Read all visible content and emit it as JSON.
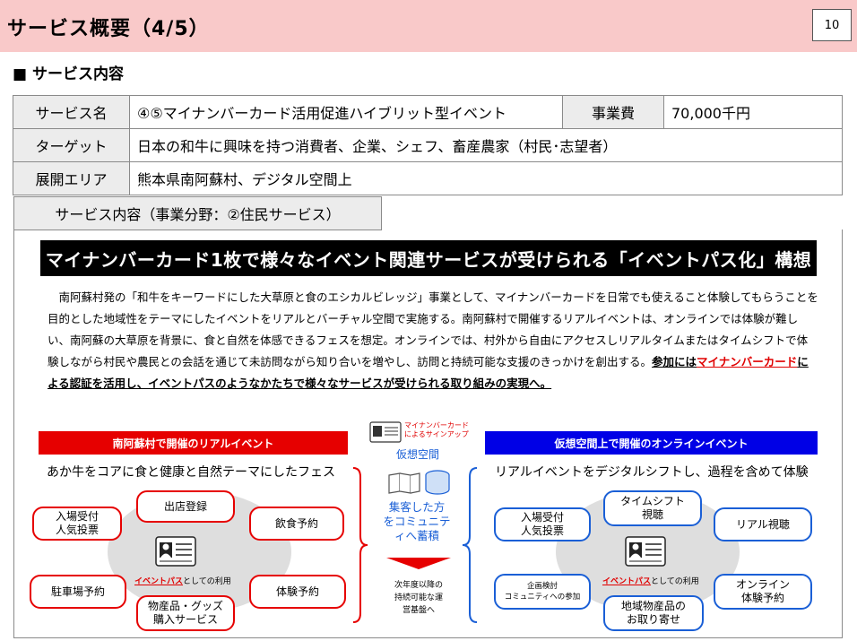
{
  "header": {
    "title": "サービス概要（4/5）",
    "page_number": "10"
  },
  "section": {
    "heading": "■ サービス内容"
  },
  "info_table": {
    "service_name_label": "サービス名",
    "service_name_value": "④⑤マイナンバーカード活用促進ハイブリット型イベント",
    "cost_label": "事業費",
    "cost_value": "70,000千円",
    "target_label": "ターゲット",
    "target_value": "日本の和牛に興味を持つ消費者、企業、シェフ、畜産農家（村民･志望者）",
    "area_label": "展開エリア",
    "area_value": "熊本県南阿蘇村、デジタル空間上",
    "content_label": "サービス内容（事業分野：②住民サービス）"
  },
  "banner": {
    "text": "マイナンバーカード1枚で様々なイベント関連サービスが受けられる「イベントパス化」構想"
  },
  "description": {
    "normal_text": "　南阿蘇村発の「和牛をキーワードにした大草原と食のエシカルビレッジ」事業として、マイナンバーカードを日常でも使えること体験してもらうことを目的とした地域性をテーマにしたイベントをリアルとバーチャル空間で実施する。南阿蘇村で開催するリアルイベントは、オンラインでは体験が難しい、南阿蘇の大草原を背景に、食と自然を体感できるフェスを想定。オンラインでは、村外から自由にアクセスしリアルタイムまたはタイムシフトで体験しながら村民や農民との会話を通じて未訪問ながら知り合いを増やし、訪問と持続可能な支援のきっかけを創出する。",
    "bold_1": "参加には",
    "bold_red": "マイナンバーカード",
    "bold_2": "による認証を活用し、イベントパスのようなかたちで様々なサービスが受けられる取り組みの実現へ。"
  },
  "real_event": {
    "title": "南阿蘇村で開催のリアルイベント",
    "subtitle": "あか牛をコアに食と健康と自然テーマにしたフェス",
    "items": [
      "入場受付\n人気投票",
      "出店登録",
      "飲食予約",
      "駐車場予約",
      "体験予約",
      "物産品・グッズ\n購入サービス"
    ],
    "card_label_red": "イベントパス",
    "card_label_rest": "としての利用"
  },
  "middle": {
    "caption": "マイナンバーカード\nによるサインアップ",
    "virtual_space": "仮想空間",
    "accumulate": "集客した方\nをコミュニテ\nィへ蓄積",
    "next_year": "次年度以降の\n持続可能な運\n営基盤へ"
  },
  "online_event": {
    "title": "仮想空間上で開催のオンラインイベント",
    "subtitle": "リアルイベントをデジタルシフトし、過程を含めて体験",
    "items": [
      "入場受付\n人気投票",
      "タイムシフト\n視聴",
      "リアル視聴",
      "企画検討\nコミュニティへの参加",
      "オンライン\n体験予約",
      "地域物産品の\nお取り寄せ"
    ],
    "card_label_red": "イベントパス",
    "card_label_rest": "としての利用"
  },
  "colors": {
    "header_bg": "#f9c9c9",
    "accent_red": "#e60000",
    "accent_blue": "#0000e6",
    "pill_blue": "#1a5fd6"
  }
}
